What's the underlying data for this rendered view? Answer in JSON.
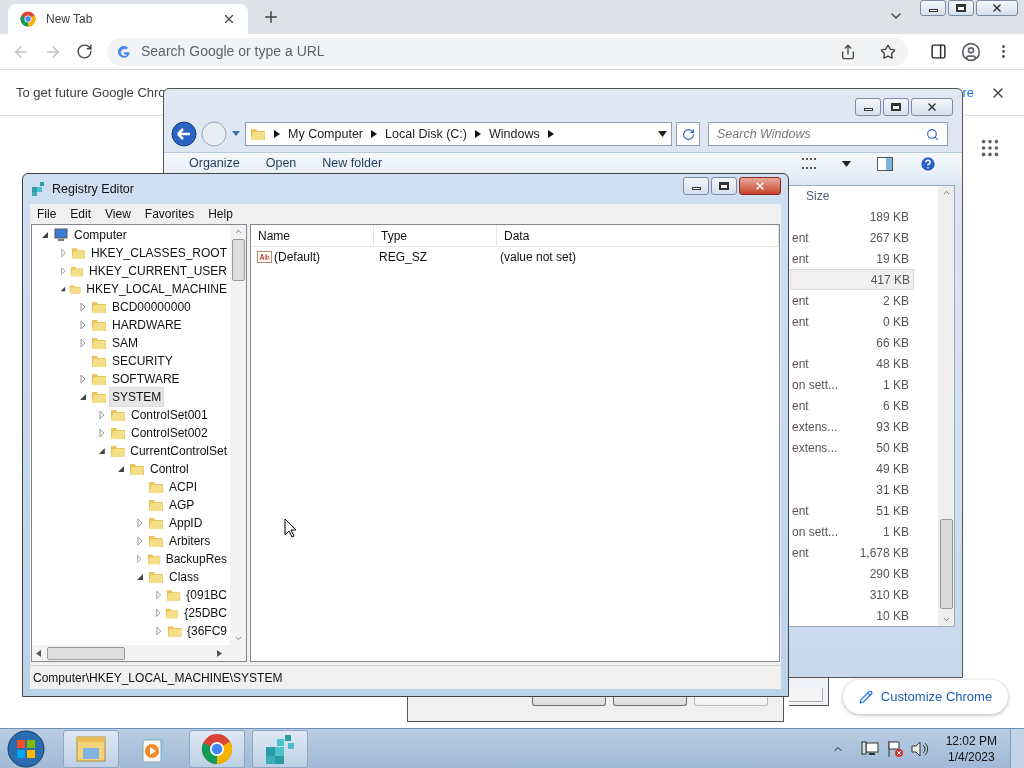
{
  "browser": {
    "tab": {
      "title": "New Tab",
      "selected": true
    },
    "back_disabled": true,
    "forward_disabled": true,
    "omnibox": {
      "placeholder": "Search Google or type a URL"
    },
    "infobar": {
      "text": "To get future Google Chro",
      "link": "re"
    },
    "customize_button": "Customize Chrome"
  },
  "explorer": {
    "breadcrumb": [
      "My Computer",
      "Local Disk (C:)",
      "Windows"
    ],
    "search": {
      "placeholder": "Search Windows"
    },
    "toolbar": [
      "Organize",
      "Open",
      "New folder"
    ],
    "size_header": "Size",
    "rows": [
      {
        "size": "189 KB",
        "selected": false
      },
      {
        "type": "ent",
        "size": "267 KB",
        "selected": false
      },
      {
        "type": "ent",
        "size": "19 KB",
        "selected": false
      },
      {
        "size": "417 KB",
        "selected": true
      },
      {
        "type": "ent",
        "size": "2 KB",
        "selected": false
      },
      {
        "type": "ent",
        "size": "0 KB",
        "selected": false
      },
      {
        "size": "66 KB",
        "selected": false
      },
      {
        "type": "ent",
        "size": "48 KB",
        "selected": false
      },
      {
        "type": "on sett...",
        "size": "1 KB",
        "selected": false
      },
      {
        "type": "ent",
        "size": "6 KB",
        "selected": false
      },
      {
        "type": "extens...",
        "size": "93 KB",
        "selected": false
      },
      {
        "type": "extens...",
        "size": "50 KB",
        "selected": false
      },
      {
        "size": "49 KB",
        "selected": false
      },
      {
        "size": "31 KB",
        "selected": false
      },
      {
        "type": "ent",
        "size": "51 KB",
        "selected": false
      },
      {
        "type": "on sett...",
        "size": "1 KB",
        "selected": false
      },
      {
        "type": "ent",
        "size": "1,678 KB",
        "selected": false
      },
      {
        "size": "290 KB",
        "selected": false
      },
      {
        "size": "310 KB",
        "selected": false
      },
      {
        "size": "10 KB",
        "selected": false
      }
    ]
  },
  "regedit": {
    "title": "Registry Editor",
    "menu": [
      "File",
      "Edit",
      "View",
      "Favorites",
      "Help"
    ],
    "tree": [
      {
        "label": "Computer",
        "kind": "branch",
        "expanded": true,
        "selected": false,
        "children": [
          {
            "label": "HKEY_CLASSES_ROOT",
            "kind": "branch",
            "expanded": false,
            "selected": false
          },
          {
            "label": "HKEY_CURRENT_USER",
            "kind": "branch",
            "expanded": false,
            "selected": false
          },
          {
            "label": "HKEY_LOCAL_MACHINE",
            "kind": "branch",
            "expanded": true,
            "selected": false,
            "children": [
              {
                "label": "BCD00000000",
                "kind": "branch",
                "expanded": false,
                "selected": false
              },
              {
                "label": "HARDWARE",
                "kind": "branch",
                "expanded": false,
                "selected": false
              },
              {
                "label": "SAM",
                "kind": "branch",
                "expanded": false,
                "selected": false
              },
              {
                "label": "SECURITY",
                "kind": "leaf",
                "selected": false
              },
              {
                "label": "SOFTWARE",
                "kind": "branch",
                "expanded": false,
                "selected": false
              },
              {
                "label": "SYSTEM",
                "kind": "branch",
                "expanded": true,
                "selected": true,
                "children": [
                  {
                    "label": "ControlSet001",
                    "kind": "branch",
                    "expanded": false,
                    "selected": false
                  },
                  {
                    "label": "ControlSet002",
                    "kind": "branch",
                    "expanded": false,
                    "selected": false
                  },
                  {
                    "label": "CurrentControlSet",
                    "kind": "branch",
                    "expanded": true,
                    "selected": false,
                    "children": [
                      {
                        "label": "Control",
                        "kind": "branch",
                        "expanded": true,
                        "selected": false,
                        "children": [
                          {
                            "label": "ACPI",
                            "kind": "leaf",
                            "selected": false
                          },
                          {
                            "label": "AGP",
                            "kind": "leaf",
                            "selected": false
                          },
                          {
                            "label": "AppID",
                            "kind": "branch",
                            "expanded": false,
                            "selected": false
                          },
                          {
                            "label": "Arbiters",
                            "kind": "branch",
                            "expanded": false,
                            "selected": false
                          },
                          {
                            "label": "BackupRes",
                            "kind": "branch",
                            "expanded": false,
                            "selected": false
                          },
                          {
                            "label": "Class",
                            "kind": "branch",
                            "expanded": true,
                            "selected": false,
                            "children": [
                              {
                                "label": "{091BC",
                                "kind": "branch",
                                "expanded": false,
                                "selected": false
                              },
                              {
                                "label": "{25DBC",
                                "kind": "branch",
                                "expanded": false,
                                "selected": false
                              },
                              {
                                "label": "{36FC9",
                                "kind": "branch",
                                "expanded": false,
                                "selected": false
                              }
                            ]
                          }
                        ]
                      }
                    ]
                  }
                ]
              }
            ]
          }
        ]
      }
    ],
    "columns": [
      "Name",
      "Type",
      "Data"
    ],
    "values": [
      {
        "name": "(Default)",
        "type": "REG_SZ",
        "data": "(value not set)"
      }
    ],
    "status": "Computer\\HKEY_LOCAL_MACHINE\\SYSTEM"
  },
  "taskbar": {
    "apps": [
      {
        "kind": "explorer",
        "open": true
      },
      {
        "kind": "media",
        "open": false
      },
      {
        "kind": "chrome",
        "open": true
      },
      {
        "kind": "regedit",
        "open": true
      }
    ],
    "time": "12:02 PM",
    "date": "1/4/2023"
  }
}
